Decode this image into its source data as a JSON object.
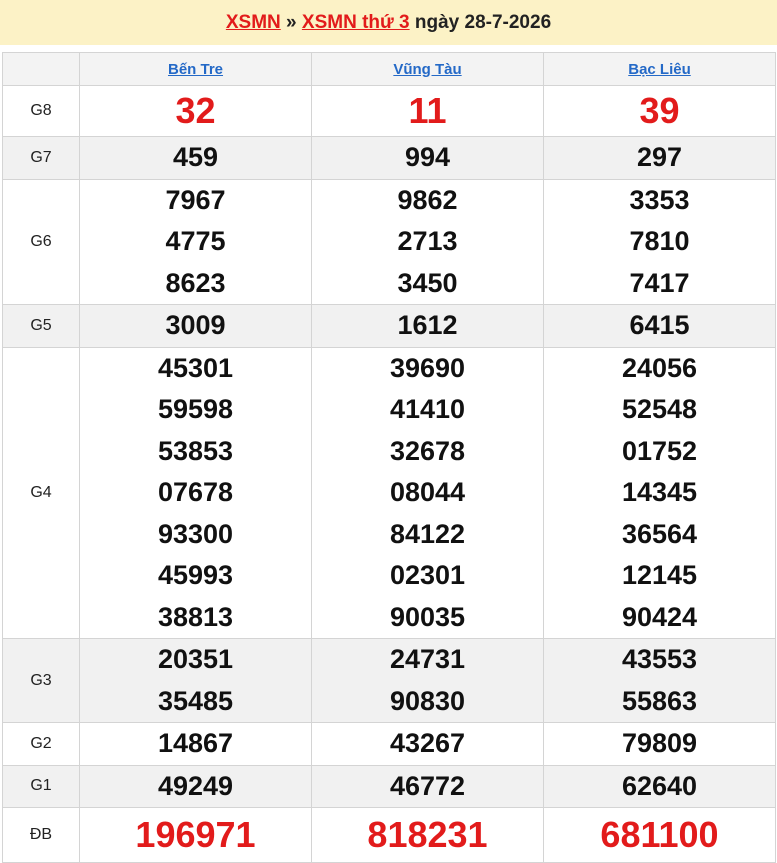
{
  "header": {
    "link1": "XSMN",
    "sep": " » ",
    "link2": "XSMN thứ 3",
    "date_text": " ngày 28-7-2026"
  },
  "provinces": [
    "Bến Tre",
    "Vũng Tàu",
    "Bạc Liêu"
  ],
  "prizes": [
    {
      "label": "G8",
      "values": [
        [
          "32"
        ],
        [
          "11"
        ],
        [
          "39"
        ]
      ]
    },
    {
      "label": "G7",
      "values": [
        [
          "459"
        ],
        [
          "994"
        ],
        [
          "297"
        ]
      ]
    },
    {
      "label": "G6",
      "values": [
        [
          "7967",
          "4775",
          "8623"
        ],
        [
          "9862",
          "2713",
          "3450"
        ],
        [
          "3353",
          "7810",
          "7417"
        ]
      ]
    },
    {
      "label": "G5",
      "values": [
        [
          "3009"
        ],
        [
          "1612"
        ],
        [
          "6415"
        ]
      ]
    },
    {
      "label": "G4",
      "values": [
        [
          "45301",
          "59598",
          "53853",
          "07678",
          "93300",
          "45993",
          "38813"
        ],
        [
          "39690",
          "41410",
          "32678",
          "08044",
          "84122",
          "02301",
          "90035"
        ],
        [
          "24056",
          "52548",
          "01752",
          "14345",
          "36564",
          "12145",
          "90424"
        ]
      ]
    },
    {
      "label": "G3",
      "values": [
        [
          "20351",
          "35485"
        ],
        [
          "24731",
          "90830"
        ],
        [
          "43553",
          "55863"
        ]
      ]
    },
    {
      "label": "G2",
      "values": [
        [
          "14867"
        ],
        [
          "43267"
        ],
        [
          "79809"
        ]
      ]
    },
    {
      "label": "G1",
      "values": [
        [
          "49249"
        ],
        [
          "46772"
        ],
        [
          "62640"
        ]
      ]
    },
    {
      "label": "ĐB",
      "values": [
        [
          "196971"
        ],
        [
          "818231"
        ],
        [
          "681100"
        ]
      ]
    }
  ],
  "colors": {
    "accent_red": "#e21b1b",
    "link_blue": "#2469c7",
    "header_bg": "#fcf2c6",
    "alt_row_bg": "#f1f1f1"
  }
}
